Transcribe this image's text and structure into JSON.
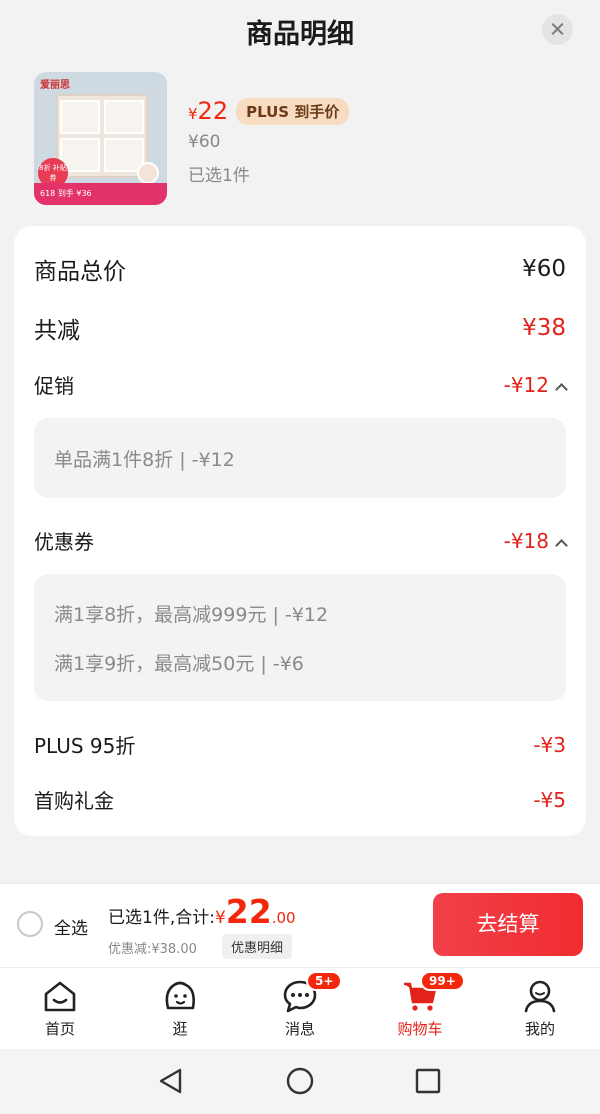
{
  "header": {
    "title": "商品明细"
  },
  "product": {
    "price_symbol": "¥",
    "price_now": "22",
    "plus_tag": "PLUS 到手价",
    "price_original": "¥60",
    "selected": "已选1件",
    "image": {
      "brand": "爱丽思",
      "banner": "618 到手 ¥36",
      "badge": "8折 补贴券"
    }
  },
  "breakdown": {
    "total_label": "商品总价",
    "total_value": "¥60",
    "reduce_label": "共减",
    "reduce_value": "¥38",
    "promo": {
      "label": "促销",
      "value": "-¥12",
      "items": [
        "单品满1件8折 | -¥12"
      ]
    },
    "coupon": {
      "label": "优惠券",
      "value": "-¥18",
      "items": [
        "满1享8折，最高减999元 | -¥12",
        "满1享9折，最高减50元 | -¥6"
      ]
    },
    "plus": {
      "label": "PLUS 95折",
      "value": "-¥3"
    },
    "first": {
      "label": "首购礼金",
      "value": "-¥5"
    }
  },
  "checkout": {
    "select_all": "全选",
    "summary_prefix": "已选1件,合计:",
    "total_symbol": "¥",
    "total_int": "22",
    "total_dec": ".00",
    "saved": "优惠减:¥38.00",
    "detail_button": "优惠明细",
    "pay_button": "去结算"
  },
  "tabbar": {
    "home": "首页",
    "browse": "逛",
    "messages": "消息",
    "messages_badge": "5+",
    "cart": "购物车",
    "cart_badge": "99+",
    "mine": "我的"
  },
  "colors": {
    "accent": "#e2231a",
    "pay": "#f02c30",
    "plus_tag_bg": "#f8dcc2"
  }
}
